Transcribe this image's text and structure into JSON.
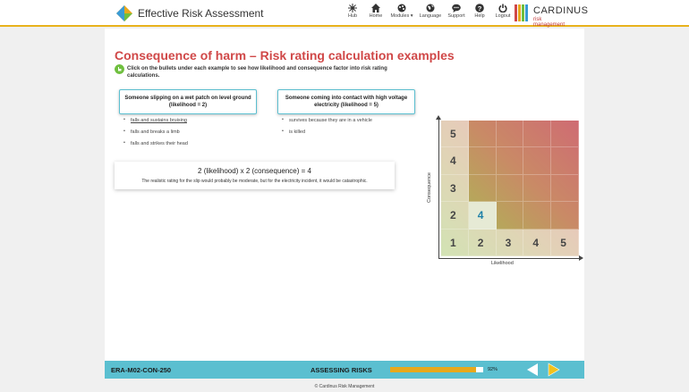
{
  "header": {
    "app_title": "Effective Risk Assessment",
    "nav": [
      {
        "label": "Hub",
        "icon": "hub-icon"
      },
      {
        "label": "Home",
        "icon": "home-icon"
      },
      {
        "label": "Modules ▾",
        "icon": "modules-icon"
      },
      {
        "label": "Language",
        "icon": "globe-icon"
      },
      {
        "label": "Support",
        "icon": "chat-icon"
      },
      {
        "label": "Help",
        "icon": "help-icon"
      },
      {
        "label": "Logout",
        "icon": "power-icon"
      }
    ],
    "brand_name": "CARDINUS",
    "brand_sub": "risk management"
  },
  "main": {
    "title": "Consequence of harm – Risk rating calculation examples",
    "instructions": "Click on the bullets under each example to see how likelihood and consequence factor into risk rating calculations.",
    "examples": [
      {
        "label": "Someone slipping on a wet patch on level ground (likelihood = 2)",
        "bullets": [
          "falls and sustains bruising",
          "falls and breaks a limb",
          "falls and strikes their head"
        ]
      },
      {
        "label": "Someone coming into contact with high voltage electricity (likelihood = 5)",
        "bullets": [
          "survives because they are in a vehicle",
          "is killed"
        ]
      }
    ],
    "calc_equation": "2 (likelihood) x 2 (consequence) = 4",
    "calc_note": "The realistic rating for the slip would probably be moderate, but for the electricity incident, it would be catastrophic."
  },
  "matrix": {
    "ylabel": "Consequence",
    "xlabel": "Likelihood",
    "cells": [
      {
        "text": "5",
        "col": 0,
        "row": 0
      },
      {
        "text": "4",
        "col": 0,
        "row": 1
      },
      {
        "text": "3",
        "col": 0,
        "row": 2
      },
      {
        "text": "2",
        "col": 0,
        "row": 3
      },
      {
        "text": "4",
        "col": 1,
        "row": 3
      },
      {
        "text": "1",
        "col": 0,
        "row": 4
      },
      {
        "text": "2",
        "col": 1,
        "row": 4
      },
      {
        "text": "3",
        "col": 2,
        "row": 4
      },
      {
        "text": "4",
        "col": 3,
        "row": 4
      },
      {
        "text": "5",
        "col": 4,
        "row": 4
      }
    ]
  },
  "footer": {
    "course_code": "ERA-M02-CON-250",
    "section": "ASSESSING RISKS",
    "progress": 0.92,
    "progress_label": "92%",
    "copyright": "© Cardinus Risk Management"
  },
  "colors": {
    "accent": "#d04848",
    "teal": "#5bbfd0",
    "gold": "#e8a81c"
  }
}
